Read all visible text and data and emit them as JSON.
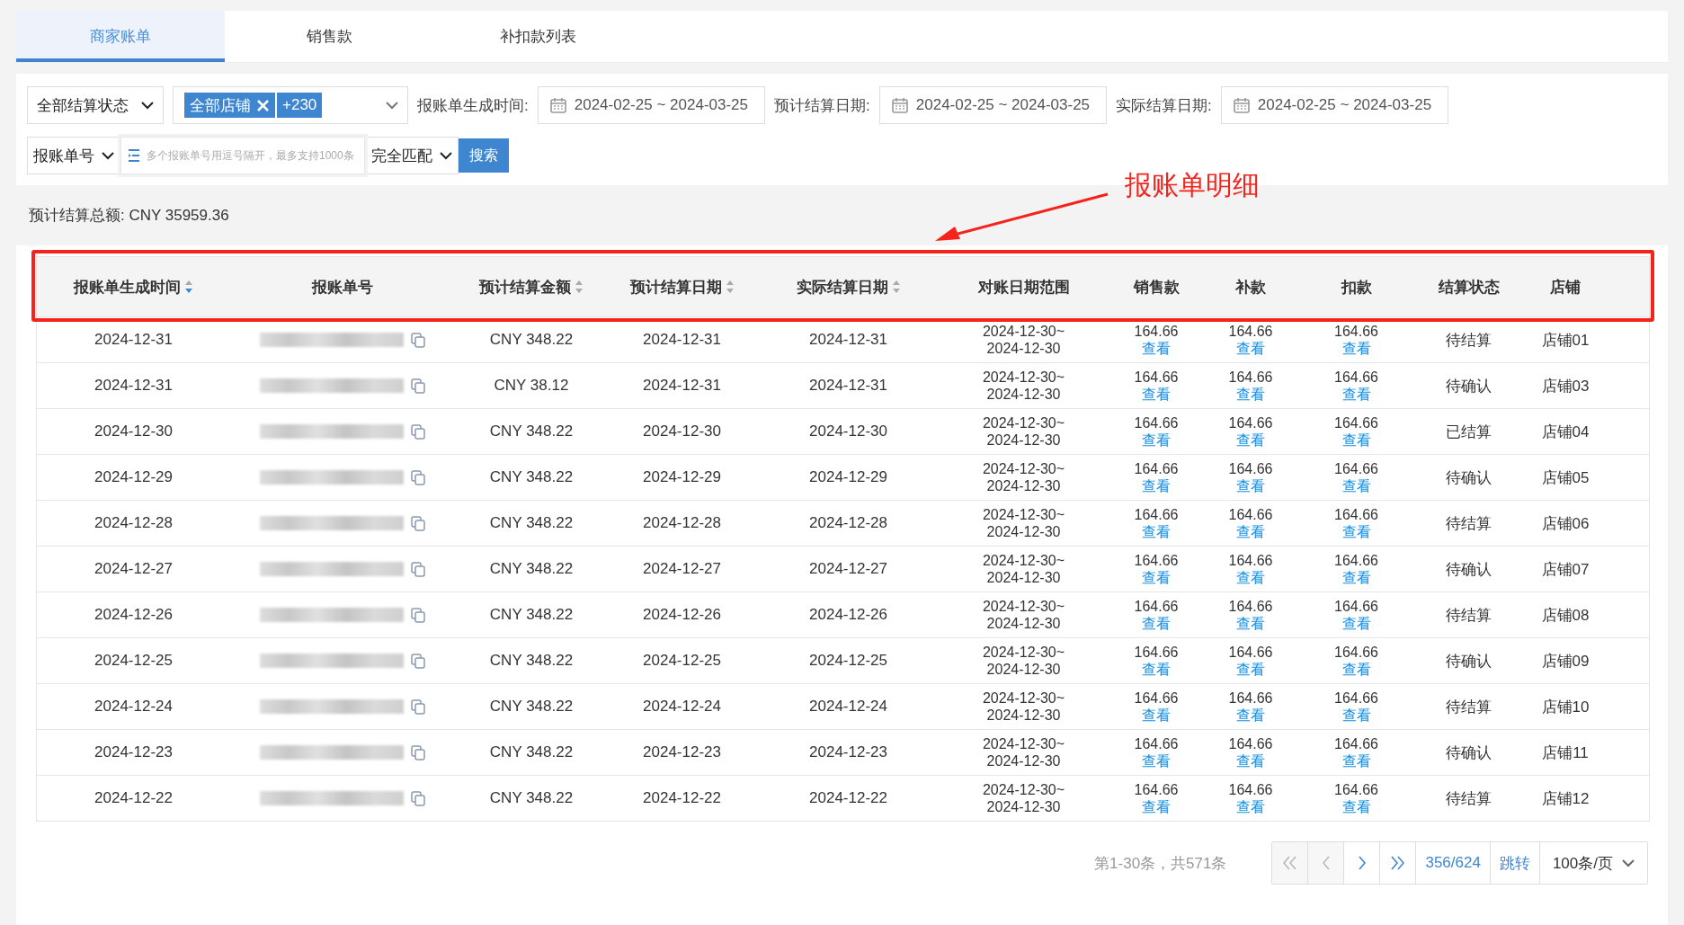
{
  "tabs": [
    {
      "label": "商家账单",
      "selected": true
    },
    {
      "label": "销售款",
      "selected": false
    },
    {
      "label": "补扣款列表",
      "selected": false
    }
  ],
  "filters": {
    "status_select": "全部结算状态",
    "shop_select": {
      "tag": "全部店铺",
      "more": "+230"
    },
    "date_ranges": [
      {
        "label": "报账单生成时间:",
        "value": "2024-02-25 ~ 2024-03-25"
      },
      {
        "label": "预计结算日期:",
        "value": "2024-02-25 ~ 2024-03-25"
      },
      {
        "label": "实际结算日期:",
        "value": "2024-02-25 ~ 2024-03-25"
      }
    ],
    "field_select": "报账单号",
    "search_field": {
      "placeholder": "多个报账单号用逗号隔开，最多支持1000条"
    },
    "match_select": "完全匹配",
    "search_button": "搜索"
  },
  "total": "预计结算总额: CNY 35959.36",
  "annotation": {
    "label": "报账单明细"
  },
  "table": {
    "columns": [
      {
        "label": "报账单生成时间",
        "sorted": true
      },
      {
        "label": "报账单号"
      },
      {
        "label": "预计结算金额",
        "sorted": false
      },
      {
        "label": "预计结算日期",
        "sorted": false
      },
      {
        "label": "实际结算日期",
        "sorted": false
      },
      {
        "label": "对账日期范围"
      },
      {
        "label": "销售款"
      },
      {
        "label": "补款"
      },
      {
        "label": "扣款"
      },
      {
        "label": "结算状态"
      },
      {
        "label": "店铺"
      }
    ],
    "rows": [
      {
        "created": "2024-12-31",
        "amount": "CNY 348.22",
        "est_date": "2024-12-31",
        "actual_date": "2024-12-31",
        "range_from": "2024-12-30~",
        "range_to": "2024-12-30",
        "sales": {
          "amount": "164.66",
          "link": "查看"
        },
        "supplement": {
          "amount": "164.66",
          "link": "查看"
        },
        "deduction": {
          "amount": "164.66",
          "link": "查看"
        },
        "status": "待结算",
        "shop": "店铺01"
      },
      {
        "created": "2024-12-31",
        "amount": "CNY 38.12",
        "est_date": "2024-12-31",
        "actual_date": "2024-12-31",
        "range_from": "2024-12-30~",
        "range_to": "2024-12-30",
        "sales": {
          "amount": "164.66",
          "link": "查看"
        },
        "supplement": {
          "amount": "164.66",
          "link": "查看"
        },
        "deduction": {
          "amount": "164.66",
          "link": "查看"
        },
        "status": "待确认",
        "shop": "店铺03"
      },
      {
        "created": "2024-12-30",
        "amount": "CNY 348.22",
        "est_date": "2024-12-30",
        "actual_date": "2024-12-30",
        "range_from": "2024-12-30~",
        "range_to": "2024-12-30",
        "sales": {
          "amount": "164.66",
          "link": "查看"
        },
        "supplement": {
          "amount": "164.66",
          "link": "查看"
        },
        "deduction": {
          "amount": "164.66",
          "link": "查看"
        },
        "status": "已结算",
        "shop": "店铺04"
      },
      {
        "created": "2024-12-29",
        "amount": "CNY 348.22",
        "est_date": "2024-12-29",
        "actual_date": "2024-12-29",
        "range_from": "2024-12-30~",
        "range_to": "2024-12-30",
        "sales": {
          "amount": "164.66",
          "link": "查看"
        },
        "supplement": {
          "amount": "164.66",
          "link": "查看"
        },
        "deduction": {
          "amount": "164.66",
          "link": "查看"
        },
        "status": "待确认",
        "shop": "店铺05"
      },
      {
        "created": "2024-12-28",
        "amount": "CNY 348.22",
        "est_date": "2024-12-28",
        "actual_date": "2024-12-28",
        "range_from": "2024-12-30~",
        "range_to": "2024-12-30",
        "sales": {
          "amount": "164.66",
          "link": "查看"
        },
        "supplement": {
          "amount": "164.66",
          "link": "查看"
        },
        "deduction": {
          "amount": "164.66",
          "link": "查看"
        },
        "status": "待结算",
        "shop": "店铺06"
      },
      {
        "created": "2024-12-27",
        "amount": "CNY 348.22",
        "est_date": "2024-12-27",
        "actual_date": "2024-12-27",
        "range_from": "2024-12-30~",
        "range_to": "2024-12-30",
        "sales": {
          "amount": "164.66",
          "link": "查看"
        },
        "supplement": {
          "amount": "164.66",
          "link": "查看"
        },
        "deduction": {
          "amount": "164.66",
          "link": "查看"
        },
        "status": "待确认",
        "shop": "店铺07"
      },
      {
        "created": "2024-12-26",
        "amount": "CNY 348.22",
        "est_date": "2024-12-26",
        "actual_date": "2024-12-26",
        "range_from": "2024-12-30~",
        "range_to": "2024-12-30",
        "sales": {
          "amount": "164.66",
          "link": "查看"
        },
        "supplement": {
          "amount": "164.66",
          "link": "查看"
        },
        "deduction": {
          "amount": "164.66",
          "link": "查看"
        },
        "status": "待结算",
        "shop": "店铺08"
      },
      {
        "created": "2024-12-25",
        "amount": "CNY 348.22",
        "est_date": "2024-12-25",
        "actual_date": "2024-12-25",
        "range_from": "2024-12-30~",
        "range_to": "2024-12-30",
        "sales": {
          "amount": "164.66",
          "link": "查看"
        },
        "supplement": {
          "amount": "164.66",
          "link": "查看"
        },
        "deduction": {
          "amount": "164.66",
          "link": "查看"
        },
        "status": "待确认",
        "shop": "店铺09"
      },
      {
        "created": "2024-12-24",
        "amount": "CNY 348.22",
        "est_date": "2024-12-24",
        "actual_date": "2024-12-24",
        "range_from": "2024-12-30~",
        "range_to": "2024-12-30",
        "sales": {
          "amount": "164.66",
          "link": "查看"
        },
        "supplement": {
          "amount": "164.66",
          "link": "查看"
        },
        "deduction": {
          "amount": "164.66",
          "link": "查看"
        },
        "status": "待结算",
        "shop": "店铺10"
      },
      {
        "created": "2024-12-23",
        "amount": "CNY 348.22",
        "est_date": "2024-12-23",
        "actual_date": "2024-12-23",
        "range_from": "2024-12-30~",
        "range_to": "2024-12-30",
        "sales": {
          "amount": "164.66",
          "link": "查看"
        },
        "supplement": {
          "amount": "164.66",
          "link": "查看"
        },
        "deduction": {
          "amount": "164.66",
          "link": "查看"
        },
        "status": "待确认",
        "shop": "店铺11"
      },
      {
        "created": "2024-12-22",
        "amount": "CNY 348.22",
        "est_date": "2024-12-22",
        "actual_date": "2024-12-22",
        "range_from": "2024-12-30~",
        "range_to": "2024-12-30",
        "sales": {
          "amount": "164.66",
          "link": "查看"
        },
        "supplement": {
          "amount": "164.66",
          "link": "查看"
        },
        "deduction": {
          "amount": "164.66",
          "link": "查看"
        },
        "status": "待结算",
        "shop": "店铺12"
      }
    ]
  },
  "pagination": {
    "info": "第1-30条，共571条",
    "buttons": [
      {
        "kind": "first",
        "disabled": true
      },
      {
        "kind": "prev",
        "disabled": true
      },
      {
        "kind": "next",
        "disabled": false
      },
      {
        "kind": "last",
        "disabled": false
      }
    ],
    "page": "356/624",
    "jump": "跳转",
    "page_size": "100条/页"
  }
}
